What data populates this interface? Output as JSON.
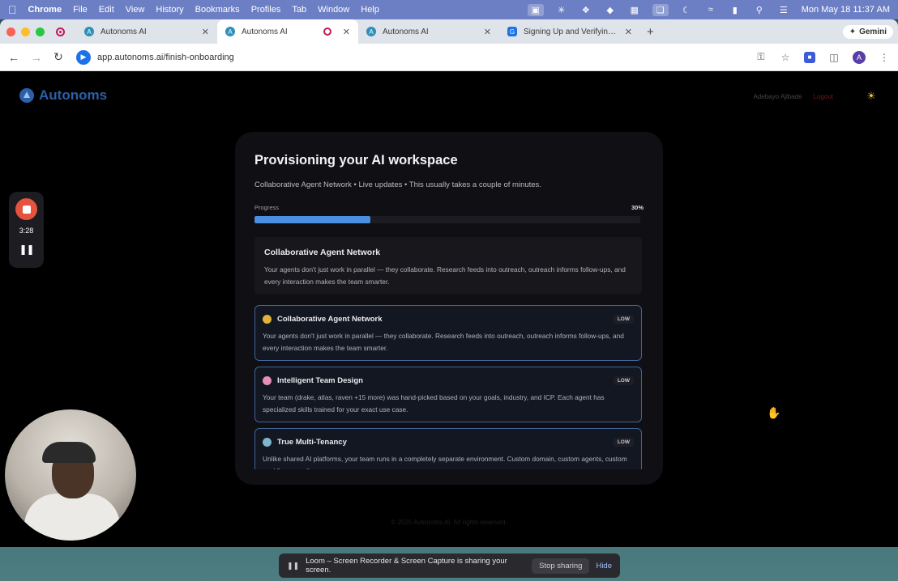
{
  "menubar": {
    "app": "Chrome",
    "menus": [
      "File",
      "Edit",
      "View",
      "History",
      "Bookmarks",
      "Profiles",
      "Tab",
      "Window",
      "Help"
    ],
    "clock": "Mon May 18  11:37 AM"
  },
  "browser": {
    "tabs": [
      {
        "title": "Autonoms AI",
        "active": false
      },
      {
        "title": "Autonoms AI",
        "active": true
      },
      {
        "title": "Autonoms AI",
        "active": false
      },
      {
        "title": "Signing Up and Verifying Yo...",
        "active": false
      }
    ],
    "gemini_label": "Gemini",
    "url": "app.autonoms.ai/finish-onboarding",
    "profile_initial": "A"
  },
  "header": {
    "brand": "Autonoms",
    "user_name": "Adebayo Ajibade",
    "logout": "Logout"
  },
  "provisioning": {
    "title": "Provisioning your AI workspace",
    "subtitle": "Collaborative Agent Network • Live updates • This usually takes a couple of minutes.",
    "progress_label": "Progress",
    "progress_text": "30%",
    "progress_value": 0.3,
    "highlight": {
      "title": "Collaborative Agent Network",
      "body": "Your agents don't just work in parallel — they collaborate. Research feeds into outreach, outreach informs follow-ups, and every interaction makes the team smarter."
    },
    "features": [
      {
        "emoji_color": "#e2b23a",
        "name": "Collaborative Agent Network",
        "badge": "LOW",
        "body": "Your agents don't just work in parallel — they collaborate. Research feeds into outreach, outreach informs follow-ups, and every interaction makes the team smarter."
      },
      {
        "emoji_color": "#e58fb8",
        "name": "Intelligent Team Design",
        "badge": "LOW",
        "body": "Your team (drake, atlas, raven +15 more) was hand-picked based on your goals, industry, and ICP. Each agent has specialized skills trained for your exact use case."
      },
      {
        "emoji_color": "#7fb6c9",
        "name": "True Multi-Tenancy",
        "badge": "LOW",
        "body": "Unlike shared AI platforms, your team runs in a completely separate environment. Custom domain, custom agents, custom workflows — all yours."
      }
    ]
  },
  "footer": "© 2025 Autonoms AI. All rights reserved.",
  "loom": {
    "timer": "3:28",
    "share_message": "Loom – Screen Recorder & Screen Capture is sharing your screen.",
    "stop_sharing": "Stop sharing",
    "hide": "Hide"
  }
}
